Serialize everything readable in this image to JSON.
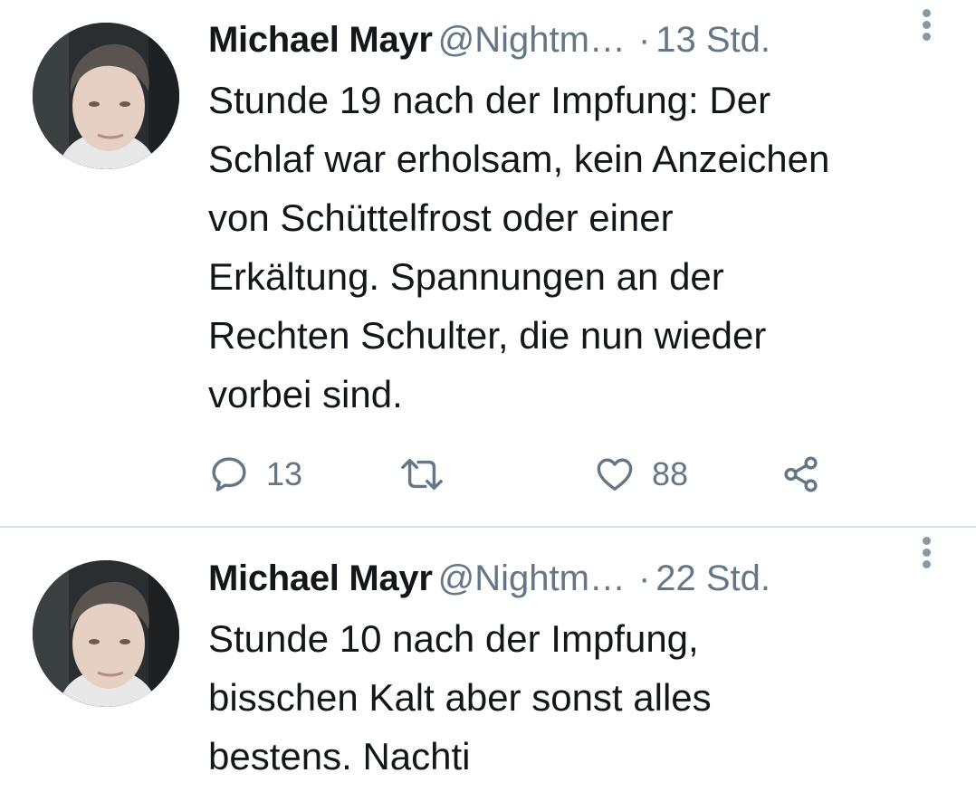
{
  "tweets": [
    {
      "author_name": "Michael Mayr",
      "handle": "@Nightm…",
      "separator": "·",
      "time": "13 Std.",
      "text": "Stunde 19 nach der Impfung: Der\nSchlaf war erholsam, kein Anzeichen\nvon Schüttelfrost oder einer\nErkältung. Spannungen an der\nRechten Schulter, die nun wieder\nvorbei sind.",
      "reply_count": "13",
      "like_count": "88",
      "icons": [
        "reply-icon",
        "retweet-icon",
        "heart-icon",
        "share-icon",
        "more-icon"
      ]
    },
    {
      "author_name": "Michael Mayr",
      "handle": "@Nightm…",
      "separator": "·",
      "time": "22 Std.",
      "text": "Stunde 10 nach der Impfung,\nbisschen Kalt aber sonst alles\nbestens. Nachti",
      "icons": [
        "more-icon"
      ]
    }
  ],
  "colors": {
    "primary_text": "#14171a",
    "secondary_text": "#657786",
    "divider": "#d5dfe4",
    "icon": "#657786"
  }
}
